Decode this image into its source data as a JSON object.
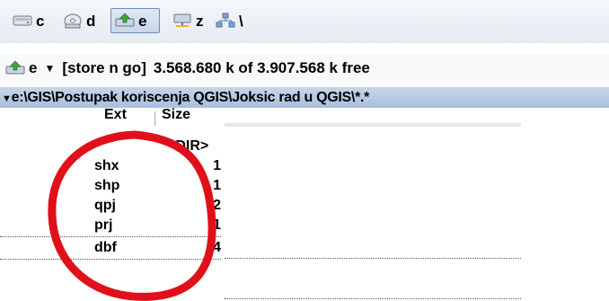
{
  "toolbar": {
    "drives": [
      {
        "letter": "c",
        "icon": "drive-icon",
        "active": false
      },
      {
        "letter": "d",
        "icon": "cd-drive-icon",
        "active": false
      },
      {
        "letter": "e",
        "icon": "usb-drive-icon",
        "active": true
      },
      {
        "letter": "z",
        "icon": "network-drive-icon",
        "active": false
      },
      {
        "letter": "\\",
        "icon": "network-neighborhood-icon",
        "active": false
      }
    ]
  },
  "path_bar": {
    "drive_letter": "e",
    "volume_label": "[store n go]",
    "free_space": "3.568.680 k of 3.907.568 k free"
  },
  "current_dir": {
    "path": "e:\\GIS\\Postupak koriscenja QGIS\\Joksic rad u QGIS\\*.*"
  },
  "columns": {
    "ext": "Ext",
    "size": "Size"
  },
  "files": [
    {
      "ext": "",
      "size": "<DIR>"
    },
    {
      "ext": "shx",
      "size": "1"
    },
    {
      "ext": "shp",
      "size": "1"
    },
    {
      "ext": "qpj",
      "size": "2"
    },
    {
      "ext": "prj",
      "size": "1"
    },
    {
      "ext": "dbf",
      "size": "4"
    }
  ],
  "colors": {
    "accent": "#a9bfdd",
    "annotation": "#e0101a"
  }
}
